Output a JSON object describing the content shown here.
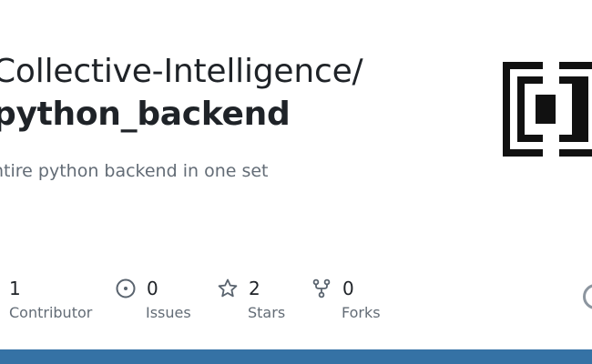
{
  "repo": {
    "owner": "Collective-Intelligence/",
    "name": "python_backend",
    "description": "ntire python backend in one set"
  },
  "stats": [
    {
      "icon": "contributor-icon",
      "value": "1",
      "label": "Contributor"
    },
    {
      "icon": "issues-icon",
      "value": "0",
      "label": "Issues"
    },
    {
      "icon": "star-icon",
      "value": "2",
      "label": "Stars"
    },
    {
      "icon": "fork-icon",
      "value": "0",
      "label": "Forks"
    }
  ],
  "colors": {
    "accent_bar": "#3572a5",
    "text_primary": "#1f2328",
    "text_muted": "#636c76"
  }
}
